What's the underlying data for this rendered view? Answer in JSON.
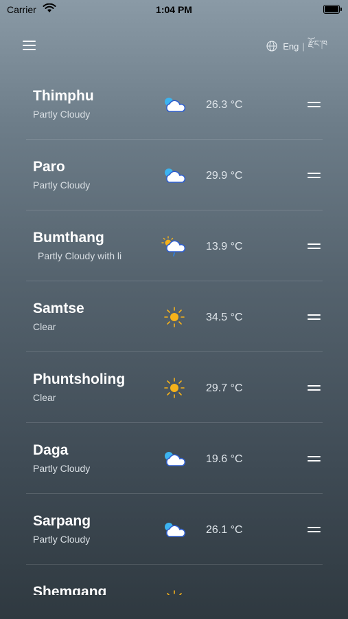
{
  "status_bar": {
    "carrier": "Carrier",
    "time": "1:04 PM"
  },
  "header": {
    "menu_icon": "hamburger-menu-icon",
    "language_icon": "globe-icon",
    "lang_english": "Eng",
    "lang_separator": "|",
    "lang_dzongkha": "རྫོང་ཁ"
  },
  "cities": [
    {
      "name": "Thimphu",
      "condition": "Partly Cloudy",
      "temperature": "26.3 °C",
      "icon": "partly-cloudy-icon"
    },
    {
      "name": "Paro",
      "condition": "Partly Cloudy",
      "temperature": "29.9 °C",
      "icon": "partly-cloudy-icon"
    },
    {
      "name": "Bumthang",
      "condition": "Partly Cloudy with li",
      "temperature": "13.9 °C",
      "icon": "partly-cloudy-light-rain-icon"
    },
    {
      "name": "Samtse",
      "condition": "Clear",
      "temperature": "34.5 °C",
      "icon": "sun-icon"
    },
    {
      "name": "Phuntsholing",
      "condition": "Clear",
      "temperature": "29.7 °C",
      "icon": "sun-icon"
    },
    {
      "name": "Daga",
      "condition": "Partly Cloudy",
      "temperature": "19.6 °C",
      "icon": "partly-cloudy-icon"
    },
    {
      "name": "Sarpang",
      "condition": "Partly Cloudy",
      "temperature": "26.1 °C",
      "icon": "partly-cloudy-icon"
    },
    {
      "name": "Shemgang",
      "condition": "",
      "temperature": "",
      "icon": "sun-icon"
    }
  ],
  "colors": {
    "sun": "#f5b21b",
    "cloud_fill": "#ffffff",
    "cloud_outline": "#2f5fd0",
    "sky_blue": "#3cb4f0",
    "rain": "#2f7fe0"
  }
}
